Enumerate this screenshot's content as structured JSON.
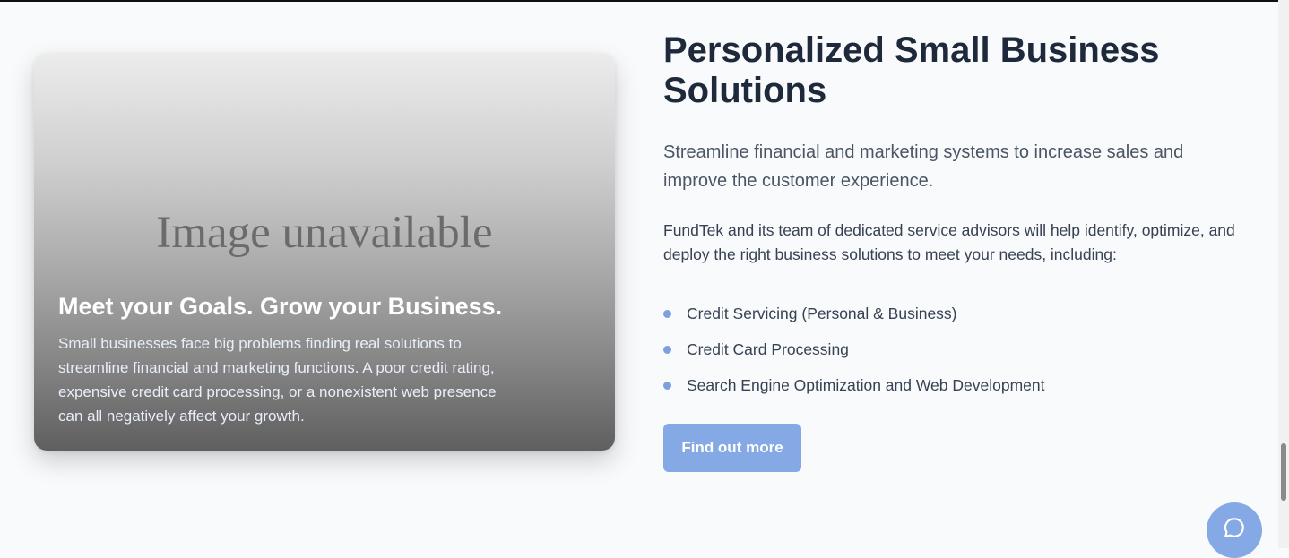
{
  "card": {
    "image_placeholder": "Image unavailable",
    "title": "Meet your Goals. Grow your Business.",
    "text": "Small businesses face big problems finding real solutions to streamline financial and marketing functions. A poor credit rating, expensive credit card processing, or a nonexistent web presence can all negatively affect your growth."
  },
  "section": {
    "heading": "Personalized Small Business Solutions",
    "lead": "Streamline financial and marketing systems to increase sales and improve the customer experience.",
    "body": "FundTek and its team of dedicated service advisors will help identify, optimize, and deploy the right business solutions to meet your needs, including:",
    "features": [
      "Credit Servicing (Personal & Business)",
      "Credit Card Processing",
      "Search Engine Optimization and Web Development"
    ],
    "cta_label": "Find out more"
  },
  "chat": {
    "icon": "chat-bubble-icon"
  },
  "colors": {
    "accent": "#84a9e5",
    "bullet": "#7ea0de",
    "heading": "#1e293b",
    "background": "#f8fafc"
  }
}
